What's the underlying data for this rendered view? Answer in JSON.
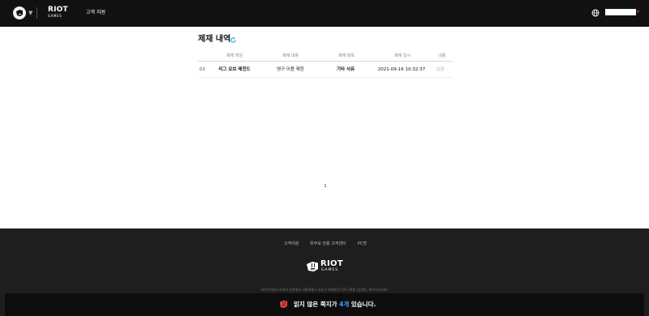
{
  "header": {
    "brand_word": "RIOT",
    "brand_sub": "GAMES",
    "nav_support": "고객 지원",
    "globe_icon": "globe-icon",
    "account_caret": "▾",
    "account_caret_color": "#e03c3c"
  },
  "main": {
    "title": "제재 내역",
    "refresh_color": "#22b8d8",
    "columns": [
      "제재 게임",
      "제재 내용",
      "제재 항목",
      "제재 일시",
      "내용"
    ],
    "rows": [
      {
        "index": "01",
        "game": "리그 오브 레전드",
        "content": "영구 이용 제한",
        "category": "기타 사유",
        "datetime": "2021-09-16 10:32:37",
        "detail": "없음"
      }
    ],
    "page": "1"
  },
  "footer": {
    "links": [
      "고객지원",
      "위부모 전용 고객센터",
      "PC방"
    ],
    "logo_word": "RIOT",
    "logo_sub": "GAMES",
    "company_line": "라이엇게임즈코리아 유한회사 서울특별시 강남구 테헤란로 521 30층 (삼성동, 파르나스타워)"
  },
  "toast": {
    "text_before": "읽지 않은 쪽지가 ",
    "count": "4개",
    "text_after": " 있습니다.",
    "accent": "#3aa3ff",
    "icon": "riot-fist-icon"
  }
}
